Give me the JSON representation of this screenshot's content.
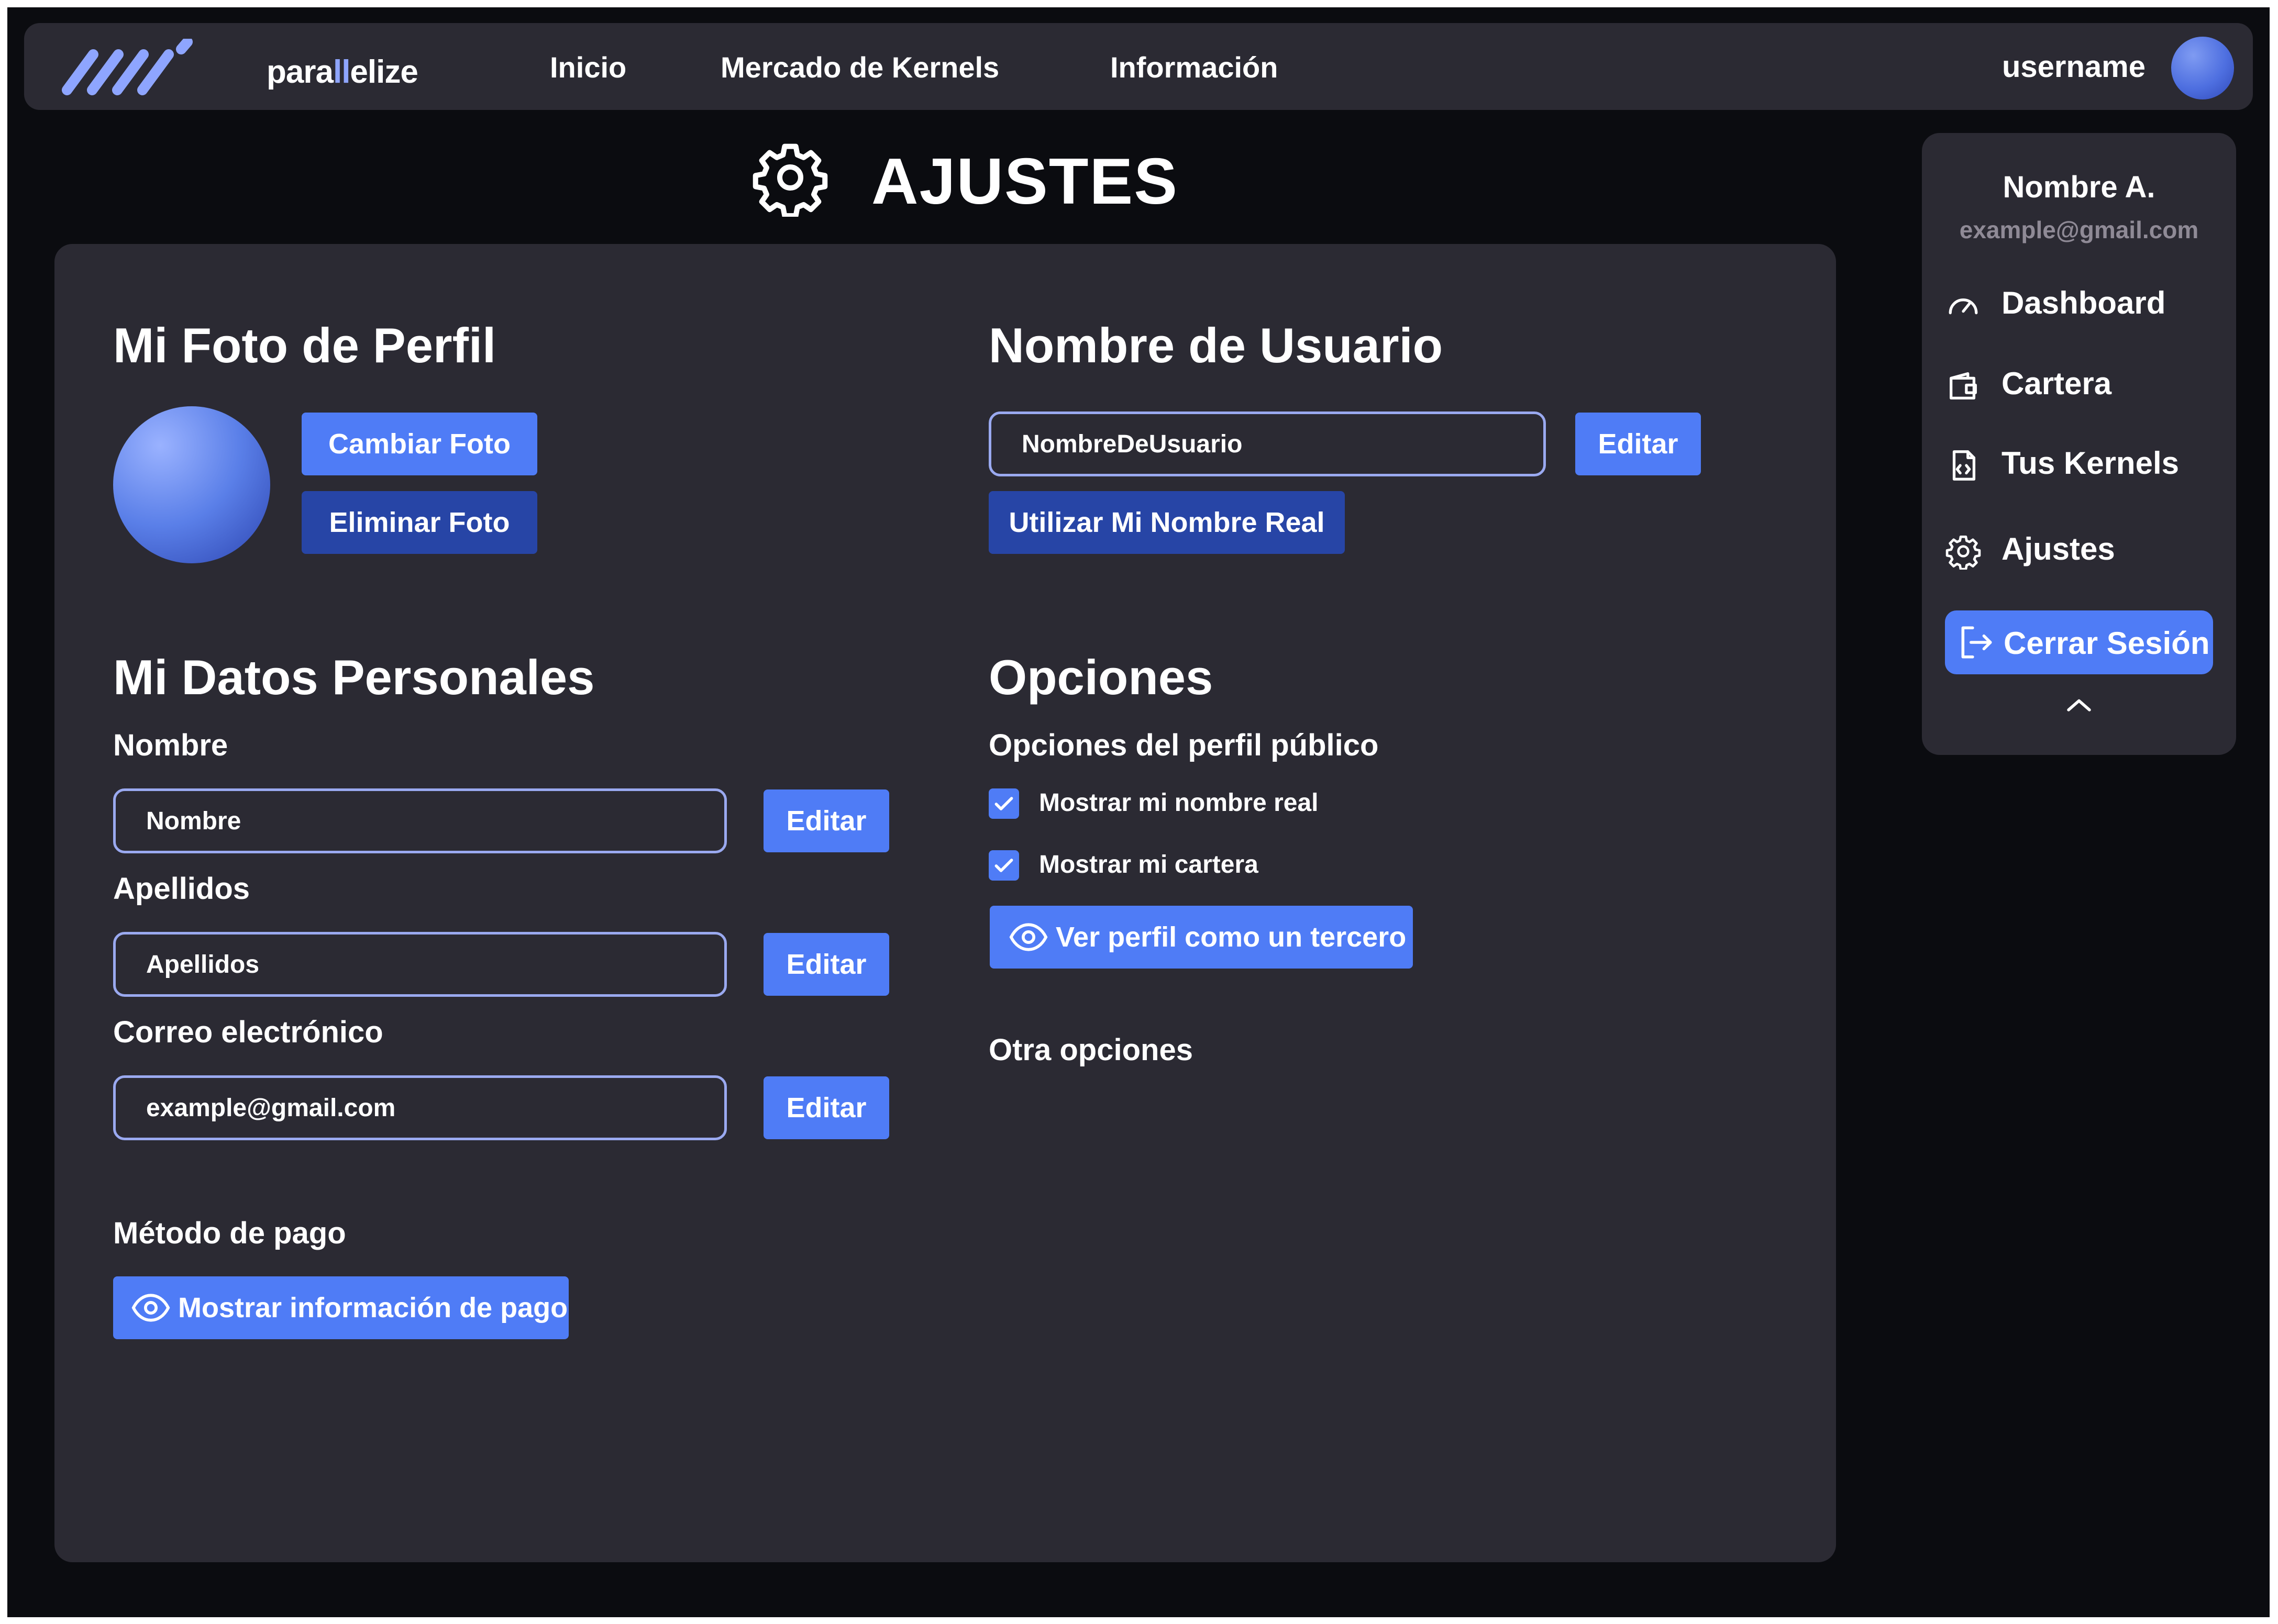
{
  "navbar": {
    "logo_part1": "para",
    "logo_part2": "ll",
    "logo_part3": "elize",
    "links": [
      "Inicio",
      "Mercado de Kernels",
      "Información"
    ],
    "username": "username"
  },
  "page": {
    "title": "AJUSTES",
    "title_icon": "gear-icon"
  },
  "profile_photo": {
    "heading": "Mi Foto de Perfil",
    "change_label": "Cambiar Foto",
    "delete_label": "Eliminar Foto"
  },
  "username_section": {
    "heading": "Nombre de Usuario",
    "value": "NombreDeUsuario",
    "edit_label": "Editar",
    "use_real_name_label": "Utilizar Mi Nombre Real"
  },
  "personal": {
    "heading": "Mi Datos Personales",
    "fields": [
      {
        "label": "Nombre",
        "value": "Nombre",
        "edit": "Editar"
      },
      {
        "label": "Apellidos",
        "value": "Apellidos",
        "edit": "Editar"
      },
      {
        "label": "Correo electrónico",
        "value": "example@gmail.com",
        "edit": "Editar"
      }
    ],
    "payment_label": "Método de pago",
    "payment_button": "Mostrar información de pago"
  },
  "options": {
    "heading": "Opciones",
    "public_profile_label": "Opciones del perfil público",
    "checkboxes": [
      {
        "label": "Mostrar mi nombre real",
        "checked": true
      },
      {
        "label": "Mostrar mi cartera",
        "checked": true
      }
    ],
    "view_as_third_party": "Ver perfil como un tercero",
    "other_options_label": "Otra opciones"
  },
  "user_menu": {
    "name": "Nombre A.",
    "email": "example@gmail.com",
    "items": [
      {
        "label": "Dashboard",
        "icon": "gauge-icon"
      },
      {
        "label": "Cartera",
        "icon": "wallet-icon"
      },
      {
        "label": "Tus Kernels",
        "icon": "code-file-icon"
      },
      {
        "label": "Ajustes",
        "icon": "gear-icon"
      }
    ],
    "logout_label": "Cerrar Sesión",
    "logout_icon": "logout-icon",
    "collapse_icon": "chevron-up-icon"
  },
  "colors": {
    "background": "#0b0c10",
    "panel": "#2b2a33",
    "accent": "#4f7cf6",
    "accent_dark": "#2745a6",
    "input_border": "#9aa9f0",
    "muted_text": "#8f8a96"
  }
}
